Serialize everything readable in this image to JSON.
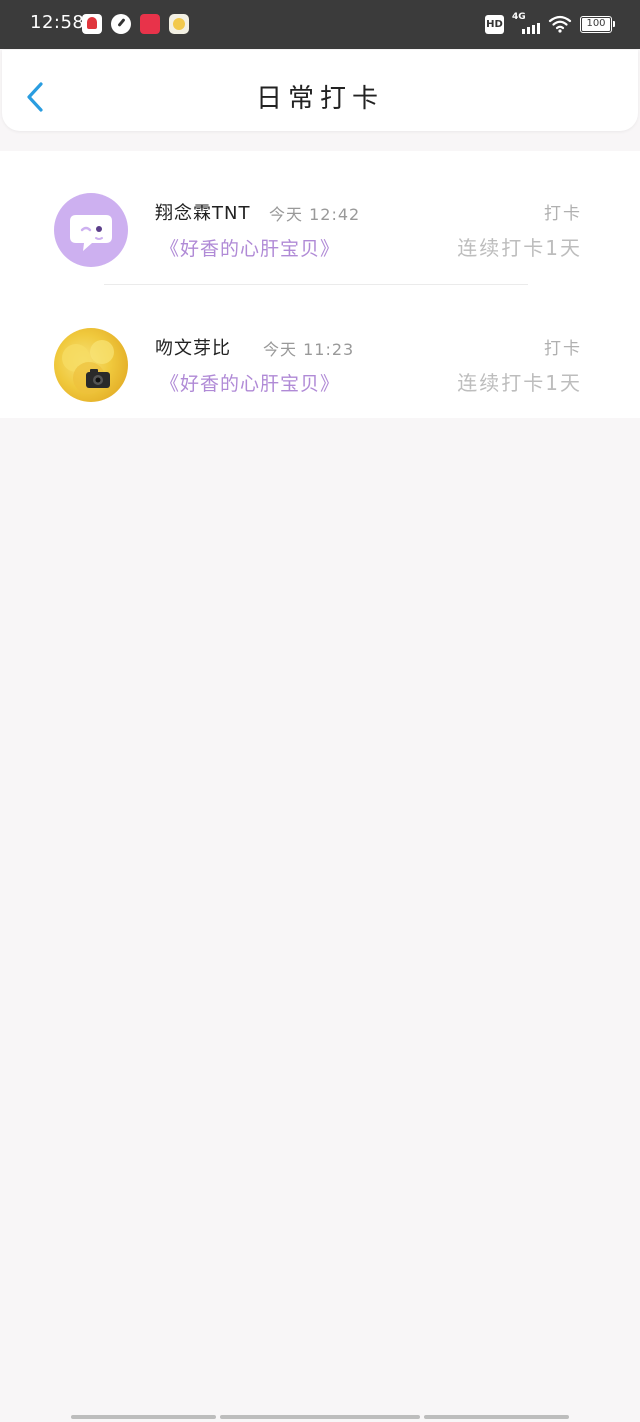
{
  "status_bar": {
    "time": "12:58",
    "hd_label": "HD",
    "network_label": "4G",
    "battery_level": "100",
    "notification_icons": [
      "app-red-icon",
      "speedometer-icon",
      "shopping-app-icon",
      "face-app-icon"
    ]
  },
  "header": {
    "title": "日常打卡",
    "back_icon": "chevron-left-icon",
    "accent_color": "#2a9de0"
  },
  "checkins": [
    {
      "username": "翔念霖TNT",
      "time": "今天 12:42",
      "action": "打卡",
      "book": "《好香的心肝宝贝》",
      "streak": "连续打卡1天",
      "avatar": "purple-chat-avatar"
    },
    {
      "username": "吻文芽比",
      "time": "今天 11:23",
      "action": "打卡",
      "book": "《好香的心肝宝贝》",
      "streak": "连续打卡1天",
      "avatar": "photo-avatar"
    }
  ],
  "colors": {
    "book_title": "#b08ad6",
    "avatar_purple": "#cdb0f0"
  }
}
